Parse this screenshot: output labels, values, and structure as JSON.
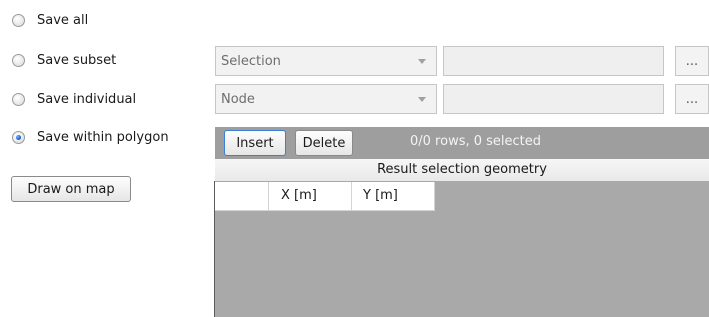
{
  "options": {
    "save_all": "Save all",
    "save_subset": "Save subset",
    "save_individual": "Save individual",
    "save_within_polygon": "Save within polygon",
    "selected": "save_within_polygon"
  },
  "draw_button": "Draw on map",
  "subset_row": {
    "combo_value": "Selection",
    "ellipsis": "..."
  },
  "individual_row": {
    "combo_value": "Node",
    "ellipsis": "..."
  },
  "toolbar": {
    "insert_label": "Insert",
    "delete_label": "Delete",
    "status": "0/0 rows, 0 selected"
  },
  "grid": {
    "title": "Result selection geometry",
    "columns": [
      "",
      "X [m]",
      "Y [m]"
    ]
  },
  "colors": {
    "toolbar_bg": "#9e9e9e",
    "grid_bg": "#a9a9a9",
    "radio_selected": "#1b5fd6"
  }
}
